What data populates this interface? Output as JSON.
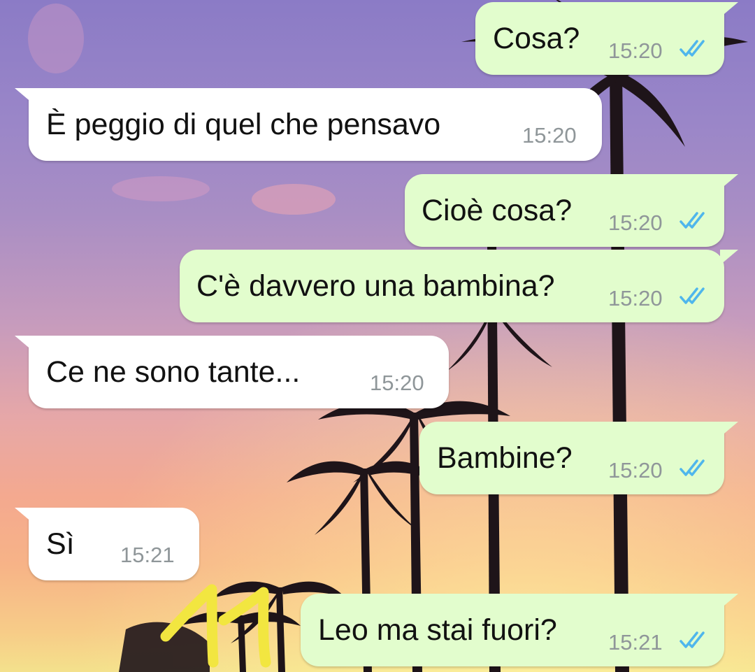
{
  "chat": {
    "messages": [
      {
        "direction": "outgoing",
        "text": "Cosa?",
        "time": "15:20",
        "status": "read"
      },
      {
        "direction": "incoming",
        "text": "È peggio di quel che pensavo",
        "time": "15:20"
      },
      {
        "direction": "outgoing",
        "text": "Cioè cosa?",
        "time": "15:20",
        "status": "read"
      },
      {
        "direction": "outgoing",
        "text": "C'è davvero una bambina?",
        "time": "15:20",
        "status": "read"
      },
      {
        "direction": "incoming",
        "text": "Ce ne sono tante...",
        "time": "15:20"
      },
      {
        "direction": "outgoing",
        "text": "Bambine?",
        "time": "15:20",
        "status": "read"
      },
      {
        "direction": "incoming",
        "text": "Sì",
        "time": "15:21"
      },
      {
        "direction": "outgoing",
        "text": "Leo ma stai fuori?",
        "time": "15:21",
        "status": "read"
      }
    ]
  },
  "annotation": {
    "text": "11",
    "color": "#f2e640"
  },
  "colors": {
    "outgoing_bubble": "#e2fdcd",
    "incoming_bubble": "#ffffff",
    "read_ticks": "#4fb6ec",
    "timestamp": "#8f9699"
  },
  "icons": {
    "read_receipt": "double-check-icon"
  }
}
